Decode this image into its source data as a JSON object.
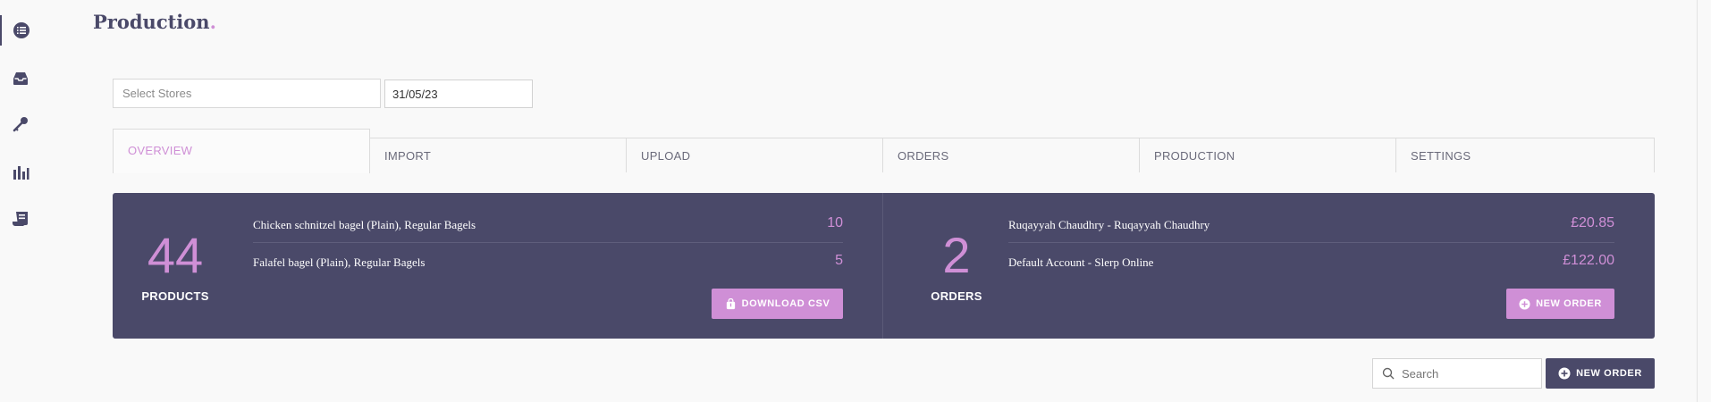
{
  "page": {
    "title": "Production",
    "title_dot": "."
  },
  "sidebar": {
    "items": [
      {
        "icon": "list-circle-icon",
        "active": true
      },
      {
        "icon": "inbox-icon",
        "active": false
      },
      {
        "icon": "key-icon",
        "active": false
      },
      {
        "icon": "bar-chart-icon",
        "active": false
      },
      {
        "icon": "receipt-icon",
        "active": false
      }
    ]
  },
  "filters": {
    "stores_placeholder": "Select Stores",
    "date_value": "31/05/23"
  },
  "tabs": [
    {
      "label": "OVERVIEW",
      "active": true
    },
    {
      "label": "IMPORT",
      "active": false
    },
    {
      "label": "UPLOAD",
      "active": false
    },
    {
      "label": "ORDERS",
      "active": false
    },
    {
      "label": "PRODUCTION",
      "active": false
    },
    {
      "label": "SETTINGS",
      "active": false
    }
  ],
  "products": {
    "count": "44",
    "label": "PRODUCTS",
    "rows": [
      {
        "name": "Chicken schnitzel bagel (Plain), Regular Bagels",
        "value": "10"
      },
      {
        "name": "Falafel bagel (Plain), Regular Bagels",
        "value": "5"
      }
    ],
    "button": "DOWNLOAD CSV"
  },
  "orders": {
    "count": "2",
    "label": "ORDERS",
    "rows": [
      {
        "name": "Ruqayyah Chaudhry - Ruqayyah Chaudhry",
        "value": "£20.85"
      },
      {
        "name": "Default Account - Slerp Online",
        "value": "£122.00"
      }
    ],
    "button": "NEW ORDER"
  },
  "toolbar": {
    "search_placeholder": "Search",
    "new_order_label": "NEW ORDER"
  },
  "colors": {
    "primary_dark": "#4a4969",
    "accent_pink": "#cf8fd6",
    "background": "#f9f9f9"
  }
}
